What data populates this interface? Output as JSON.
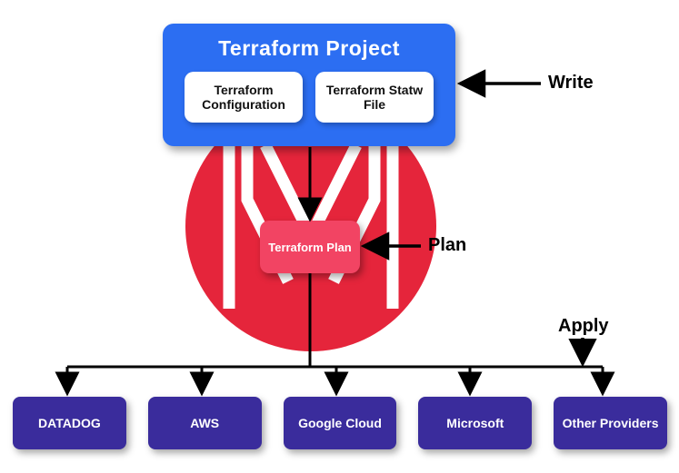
{
  "project": {
    "title": "Terraform Project",
    "cards": [
      {
        "label": "Terraform Configuration"
      },
      {
        "label": "Terraform Statw File"
      }
    ]
  },
  "plan": {
    "label": "Terraform Plan"
  },
  "providers": [
    {
      "label": "DATADOG"
    },
    {
      "label": "AWS"
    },
    {
      "label": "Google Cloud"
    },
    {
      "label": "Microsoft"
    },
    {
      "label": "Other Providers"
    }
  ],
  "labels": {
    "write": "Write",
    "plan": "Plan",
    "apply": "Apply"
  },
  "colors": {
    "project_bg": "#2C6EF2",
    "plan_bg": "#F24463",
    "provider_bg": "#3A2C9C",
    "circle": "#E5253B"
  }
}
